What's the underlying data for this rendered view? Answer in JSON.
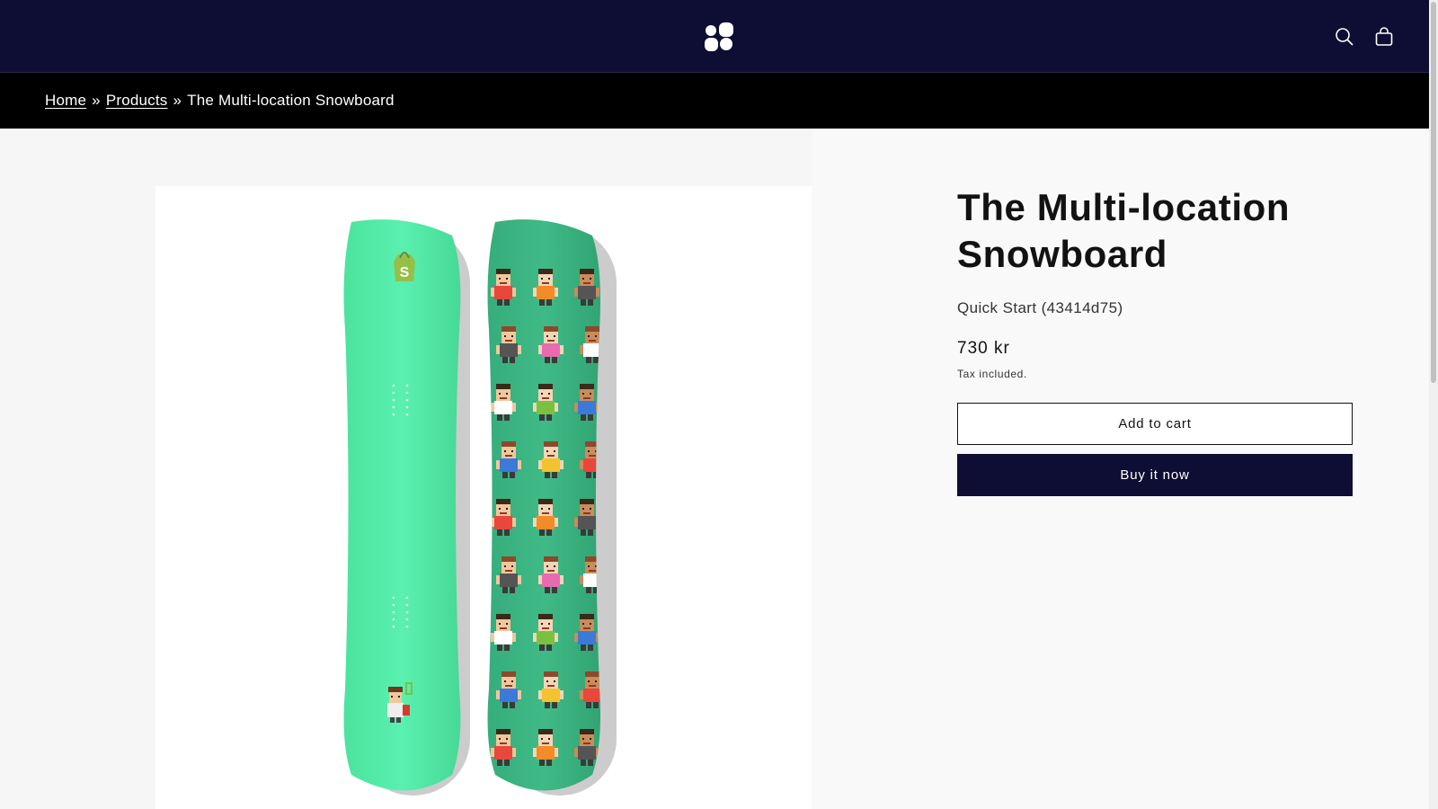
{
  "header": {
    "logo_icon": "shop-logo-dots",
    "search_icon": "search-icon",
    "cart_icon": "cart-icon",
    "background_color": "#0e0d33"
  },
  "breadcrumb": {
    "items": [
      {
        "label": "Home"
      },
      {
        "label": "Products"
      },
      {
        "label": "The Multi-location Snowboard"
      }
    ],
    "separator": "»"
  },
  "product": {
    "title": "The Multi-location Snowboard",
    "vendor": "Quick Start (43414d75)",
    "price": "730 kr",
    "tax_note": "Tax included.",
    "add_to_cart_label": "Add to cart",
    "buy_now_label": "Buy it now",
    "image_icon": "snowboard-image",
    "accent_color": "#0e0d33",
    "board_base_color": "#57eeab",
    "board_top_color": "#3bb583"
  }
}
